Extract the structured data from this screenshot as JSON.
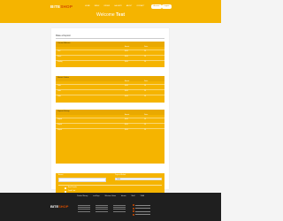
{
  "brand": {
    "part1": "BITE",
    "part2": "SHOP"
  },
  "nav": [
    "HOME",
    "MENU",
    "ORDER",
    "GALLERY",
    "ABOUT",
    "CONTACT"
  ],
  "header_buttons": {
    "account": "Account",
    "logout": "Logout"
  },
  "welcome": {
    "prefix": "Welcome",
    "name": "Test"
  },
  "page_title": "Make a Deposit",
  "cards": [
    {
      "title": "Current Balance",
      "columns": [
        "Amount",
        "Status"
      ],
      "rows": [
        {
          "label": "Total",
          "amount": "$0.00",
          "status": "OK"
        },
        {
          "label": "Bonus",
          "amount": "$0.00",
          "status": "OK"
        },
        {
          "label": "Pending",
          "amount": "$0.00",
          "status": "OK"
        }
      ]
    },
    {
      "title": "Recent Orders",
      "columns": [
        "Amount",
        "Status"
      ],
      "rows": [
        {
          "label": "Order",
          "amount": "$0.00",
          "status": "OK"
        },
        {
          "label": "Order",
          "amount": "$0.00",
          "status": "OK"
        },
        {
          "label": "Order",
          "amount": "$0.00",
          "status": "OK"
        }
      ]
    },
    {
      "title": "Deposit History",
      "columns": [
        "Amount",
        "Status"
      ],
      "rows": [
        {
          "label": "Deposit",
          "amount": "$0.00",
          "status": "OK"
        },
        {
          "label": "Deposit",
          "amount": "$0.00",
          "status": "OK"
        },
        {
          "label": "Deposit",
          "amount": "$0.00",
          "status": "OK"
        }
      ]
    }
  ],
  "form": {
    "amount_label": "Amount",
    "method_label": "Payment Method",
    "method_value": "Select",
    "options": [
      "Bank Transfer",
      "Credit Card",
      "PayPal",
      "Crypto",
      "Other"
    ],
    "submit_label": "Submit"
  },
  "partners": [
    "Perfect Money",
    "ecoPayz",
    "Western Union",
    "bitcoin",
    "Skrill",
    "VISA"
  ],
  "footer_brand": {
    "part1": "BITE",
    "part2": "SHOP"
  },
  "colors": {
    "accent": "#f5b400",
    "brand_red": "#d14b00",
    "footer": "#1f1f1f"
  }
}
